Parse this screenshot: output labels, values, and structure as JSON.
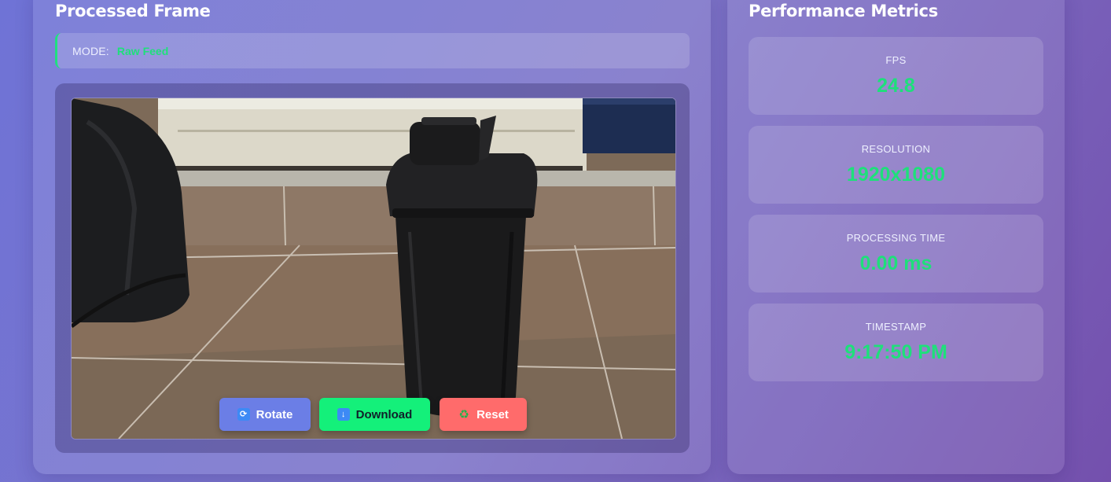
{
  "left_panel": {
    "title": "Processed Frame",
    "mode": {
      "label": "MODE:",
      "value": "Raw Feed"
    }
  },
  "buttons": {
    "rotate": "Rotate",
    "download": "Download",
    "reset": "Reset"
  },
  "right_panel": {
    "title": "Performance Metrics",
    "metrics": [
      {
        "label": "FPS",
        "value": "24.8"
      },
      {
        "label": "RESOLUTION",
        "value": "1920x1080"
      },
      {
        "label": "PROCESSING TIME",
        "value": "0.00 ms"
      },
      {
        "label": "TIMESTAMP",
        "value": "9:17:50 PM"
      }
    ]
  },
  "colors": {
    "accent_green": "#1ee07a",
    "rotate_button": "#6b7ee6",
    "download_button": "#14f07a",
    "reset_button": "#ff6b6b"
  },
  "icons": {
    "rotate": "rotate-arrows-icon",
    "download": "down-arrow-icon",
    "reset": "recycle-icon"
  }
}
